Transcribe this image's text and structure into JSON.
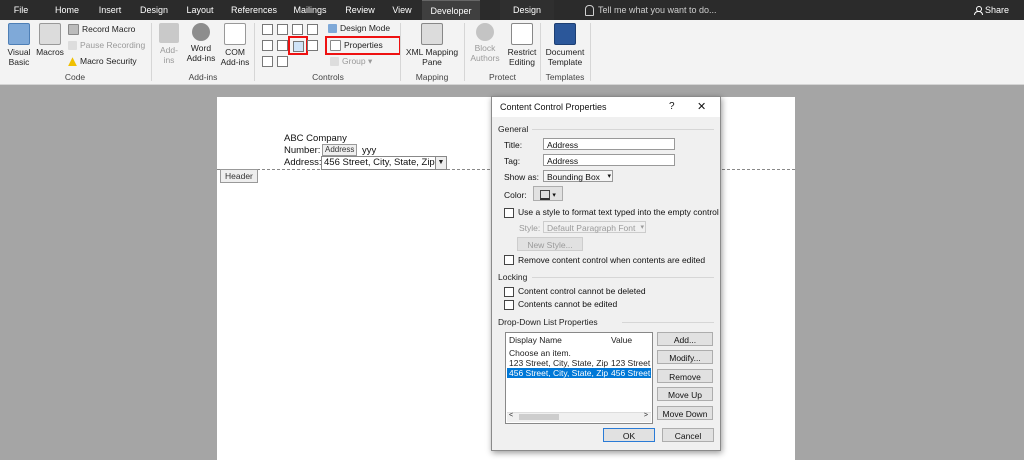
{
  "tabs": [
    {
      "label": "File"
    },
    {
      "label": "Home"
    },
    {
      "label": "Insert"
    },
    {
      "label": "Design"
    },
    {
      "label": "Layout"
    },
    {
      "label": "References"
    },
    {
      "label": "Mailings"
    },
    {
      "label": "Review"
    },
    {
      "label": "View"
    },
    {
      "label": "Developer"
    },
    {
      "label": "Design"
    }
  ],
  "tellme": "Tell me what you want to do...",
  "share": "Share",
  "ribbon": {
    "code": {
      "label": "Code",
      "visual_basic": "Visual\nBasic",
      "macros": "Macros",
      "record_macro": "Record Macro",
      "pause_recording": "Pause Recording",
      "macro_security": "Macro Security"
    },
    "addins": {
      "label": "Add-ins",
      "addins": "Add-\nins",
      "word_addins": "Word\nAdd-ins",
      "com_addins": "COM\nAdd-ins"
    },
    "controls": {
      "label": "Controls",
      "design_mode": "Design Mode",
      "properties": "Properties",
      "group": "Group"
    },
    "mapping": {
      "label": "Mapping",
      "xml_mapping": "XML Mapping\nPane"
    },
    "protect": {
      "label": "Protect",
      "block_authors": "Block\nAuthors",
      "restrict_editing": "Restrict\nEditing"
    },
    "templates": {
      "label": "Templates",
      "document_template": "Document\nTemplate"
    }
  },
  "document": {
    "company": "ABC Company",
    "number_label": "Number:",
    "number_tail": "yyy",
    "address_label": "Address:",
    "address_value": "456 Street, City, State, Zip",
    "control_tag": "Address",
    "header_label": "Header"
  },
  "dialog": {
    "title": "Content Control Properties",
    "help": "?",
    "close": "✕",
    "general": "General",
    "title_label": "Title:",
    "title_value": "Address",
    "tag_label": "Tag:",
    "tag_value": "Address",
    "showas_label": "Show as:",
    "showas_value": "Bounding Box",
    "color_label": "Color:",
    "use_style": "Use a style to format text typed into the empty control",
    "style_label": "Style:",
    "style_value": "Default Paragraph Font",
    "new_style": "New Style...",
    "remove_when_edited": "Remove content control when contents are edited",
    "locking": "Locking",
    "cannot_delete": "Content control cannot be deleted",
    "cannot_edit": "Contents cannot be edited",
    "dropdown_props": "Drop-Down List Properties",
    "col_display": "Display Name",
    "col_value": "Value",
    "items": [
      {
        "display": "Choose an item.",
        "value": ""
      },
      {
        "display": "123 Street, City, State, Zip",
        "value": "123 Street, C"
      },
      {
        "display": "456 Street, City, State, Zip",
        "value": "456 Street, C"
      }
    ],
    "btn_add": "Add...",
    "btn_modify": "Modify...",
    "btn_remove": "Remove",
    "btn_moveup": "Move Up",
    "btn_movedown": "Move Down",
    "btn_ok": "OK",
    "btn_cancel": "Cancel"
  },
  "colors": {
    "highlight": "#e11111",
    "selection": "#0078d7",
    "accent": "#2a7bd6"
  }
}
